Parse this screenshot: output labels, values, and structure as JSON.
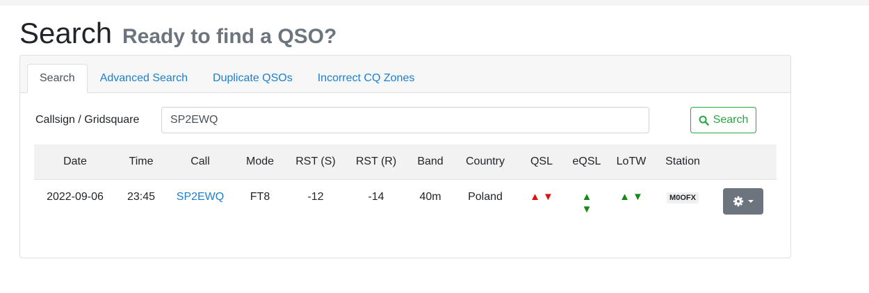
{
  "page": {
    "title": "Search",
    "subtitle": "Ready to find a QSO?"
  },
  "tabs": [
    {
      "label": "Search"
    },
    {
      "label": "Advanced Search"
    },
    {
      "label": "Duplicate QSOs"
    },
    {
      "label": "Incorrect CQ Zones"
    }
  ],
  "search": {
    "label": "Callsign / Gridsquare",
    "value": "SP2EWQ",
    "button_label": "Search",
    "button_icon": "search-icon"
  },
  "table": {
    "headers": [
      "Date",
      "Time",
      "Call",
      "Mode",
      "RST (S)",
      "RST (R)",
      "Band",
      "Country",
      "QSL",
      "eQSL",
      "LoTW",
      "Station",
      ""
    ],
    "rows": [
      {
        "date": "2022-09-06",
        "time": "23:45",
        "call": "SP2EWQ",
        "mode": "FT8",
        "rst_s": "-12",
        "rst_r": "-14",
        "band": "40m",
        "country": "Poland",
        "qsl_sent": "▲",
        "qsl_rcvd": "▼",
        "eqsl_sent": "▲",
        "eqsl_rcvd": "▼",
        "lotw_sent": "▲",
        "lotw_rcvd": "▼",
        "station": "M0OFX",
        "actions_icon": "gear-icon"
      }
    ]
  },
  "colors": {
    "link": "#1a7fd1",
    "success": "#28a745",
    "status_not_confirmed": "#e20d0d",
    "status_confirmed": "#168a16",
    "secondary_button": "#6c757d"
  }
}
